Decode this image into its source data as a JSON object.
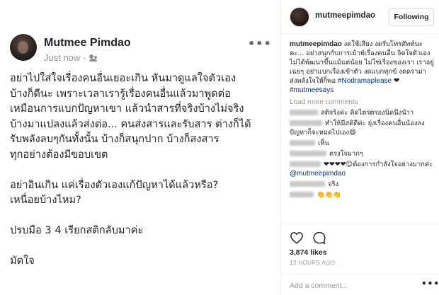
{
  "fb": {
    "author": "Mutmee Pimdao",
    "timestamp": "Just now",
    "audience_separator": "·",
    "audience_icon": "friends-icon",
    "more_label": "•••",
    "body_lines": [
      "อย่าไปใส่ใจเรื่องคนอื่นเยอะเกิน หันมาดูแลใจตัวเอง",
      "บ้างก็ดีนะ เพราะเวลาเรารู้เรื่องคนอื่นแล้วมาพูดต่อ",
      "เหมือนการแบกปัญหาเขา แล้วนำสารที่จริงบ้างไม่จริง",
      "บ้างมาแปลงแล้วส่งต่อ... คนส่งสารและรับสาร ต่างก็ได้",
      "รับพลังลบๆกันทั้งนั้น บ้างก็สนุกปาก บ้างก็สงสาร",
      "ทุกอย่างต้องมีขอบเขต"
    ],
    "body_lines_2": [
      "อย่าอินเกิน แค่เรื่องตัวเองแก้ปัญหาได้แล้วหรือ?",
      "เหนื่อยบ้างไหม?"
    ],
    "body_line_3": "ปรบมือ 3 4 เรียกสติกลับมาค่ะ",
    "body_line_4": "มัดใจ"
  },
  "ig": {
    "username": "mutmeepimdao",
    "follow_label": "Following",
    "caption_user": "mutmeepimdao",
    "caption_text": "งดใช้เสียง งดรับโทรศัพท์นะคะ... อย่าสนุกกับการเม้าท์เรื่องคนอื่น จิตใจตัวเองไม่ได้พัฒนาขึ้นแม้แต่น้อย ไม่ใช่เรื่องของเรา เราอยู่เฉยๆ อย่าแบกเรื่องเข้าตัว งดแบกทุกข์ งดดราม่า ส่งพลังใจให้ก็พอ",
    "caption_tags": [
      "#Nodramaplease",
      "❤",
      "#mutmeesays"
    ],
    "load_more": "Load more comments",
    "comments": [
      {
        "text": "สติจริงค่ะ คิดไตร่ตรองนิดนึงน้าา"
      },
      {
        "text": "ทำให้มีสติดีค่ะ ยุ่งเรื่องคนอื่นน้องลง ปัญหาก็จะหมดไปเอง😄"
      },
      {
        "text": "เห็น"
      },
      {
        "text": "ตรงใจมากๆ"
      },
      {
        "text": "❤❤❤❤😊ต้องการกำลังใจอย่างมากค่ะ",
        "mention": "@mutmeepimdao"
      },
      {
        "text": "จริง"
      },
      {
        "text": "👏👏👏"
      }
    ],
    "likes": "3,874 likes",
    "time_ago": "12 HOURS AGO",
    "add_comment_placeholder": "Add a comment...",
    "more_label": "•••"
  }
}
